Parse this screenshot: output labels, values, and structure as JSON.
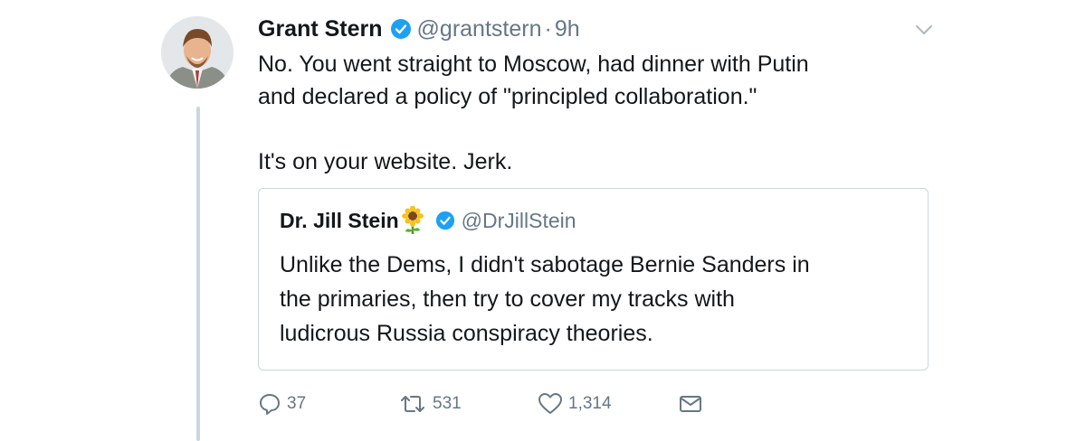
{
  "tweet": {
    "author_name": "Grant Stern",
    "handle": "@grantstern",
    "separator": "·",
    "time": "9h",
    "text_line1": "No. You went straight to Moscow, had dinner with Putin",
    "text_line2": "and declared a policy of \"principled collaboration.\"",
    "text_line3": "It's on your website. Jerk."
  },
  "quoted": {
    "author_name": "Dr. Jill Stein",
    "emoji": "sunflower-icon",
    "handle": "@DrJillStein",
    "text_line1": "Unlike the Dems, I didn't sabotage Bernie Sanders in",
    "text_line2": "the primaries, then try to cover my tracks with",
    "text_line3": "ludicrous Russia conspiracy theories."
  },
  "actions": {
    "replies": "37",
    "retweets": "531",
    "likes": "1,314"
  },
  "colors": {
    "verified": "#1da1f2",
    "secondary_text": "#657786",
    "border": "#ccd6dd"
  }
}
